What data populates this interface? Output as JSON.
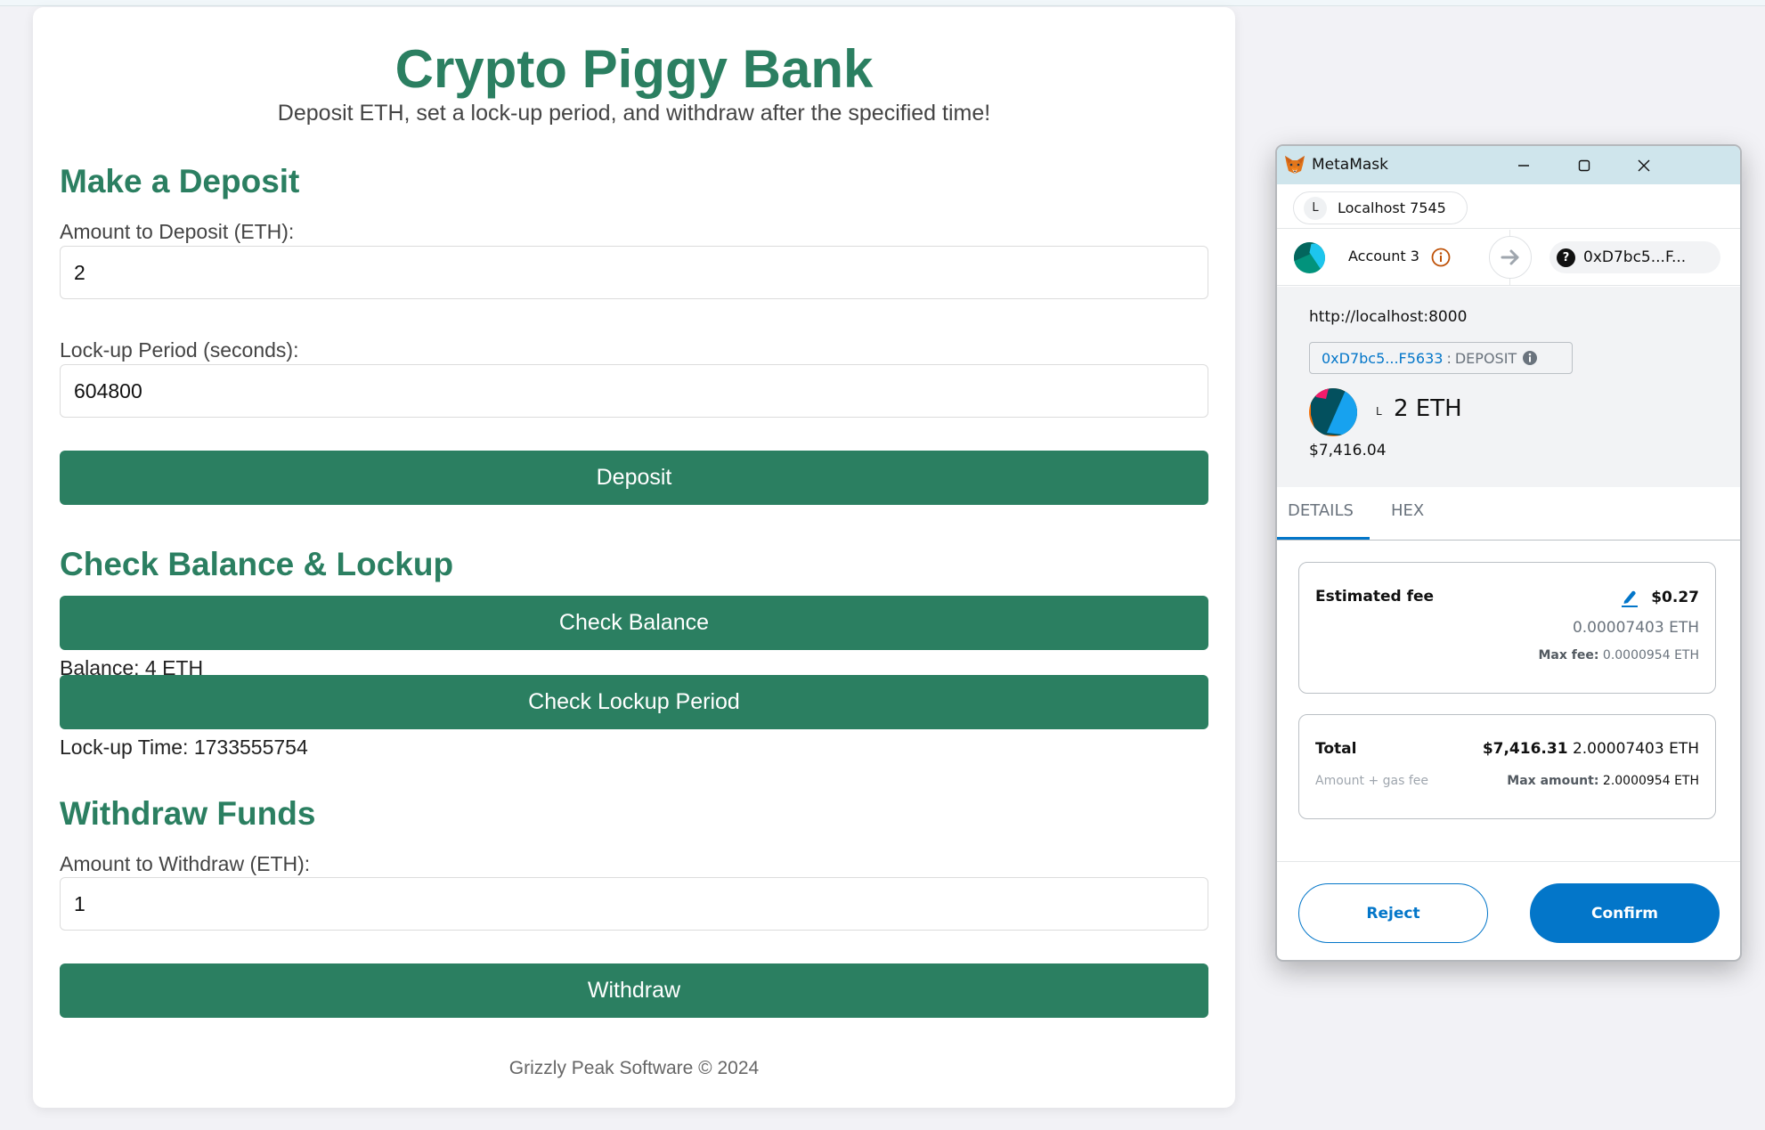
{
  "app": {
    "title": "Crypto Piggy Bank",
    "subtitle": "Deposit ETH, set a lock-up period, and withdraw after the specified time!",
    "footer": "Grizzly Peak Software © 2024",
    "accent_color": "#2b7f61"
  },
  "deposit": {
    "heading": "Make a Deposit",
    "amount_label": "Amount to Deposit (ETH):",
    "amount_value": "2",
    "lockup_label": "Lock-up Period (seconds):",
    "lockup_value": "604800",
    "button_label": "Deposit"
  },
  "check": {
    "heading": "Check Balance & Lockup",
    "balance_button": "Check Balance",
    "balance_result": "Balance: 4 ETH",
    "lockup_button": "Check Lockup Period",
    "lockup_result": "Lock-up Time: 1733555754"
  },
  "withdraw": {
    "heading": "Withdraw Funds",
    "amount_label": "Amount to Withdraw (ETH):",
    "amount_value": "1",
    "button_label": "Withdraw"
  },
  "metamask": {
    "window_title": "MetaMask",
    "network": {
      "initial": "L",
      "name": "Localhost 7545"
    },
    "account": {
      "name": "Account 3",
      "to_address": "0xD7bc5...F..."
    },
    "origin": "http://localhost:8000",
    "method": {
      "contract": "0xD7bc5...F5633",
      "separator": ":",
      "name": "DEPOSIT"
    },
    "value": {
      "network_initial": "L",
      "amount": "2 ETH",
      "usd": "$7,416.04"
    },
    "tabs": [
      {
        "label": "DETAILS",
        "active": true
      },
      {
        "label": "HEX",
        "active": false
      }
    ],
    "fee": {
      "label": "Estimated fee",
      "usd": "$0.27",
      "eth": "0.00007403 ETH",
      "max_label": "Max fee:",
      "max_value": "0.0000954 ETH"
    },
    "total": {
      "label": "Total",
      "sublabel": "Amount + gas fee",
      "usd": "$7,416.31",
      "eth": "2.00007403 ETH",
      "max_label": "Max amount:",
      "max_value": "2.0000954 ETH"
    },
    "buttons": {
      "reject": "Reject",
      "confirm": "Confirm"
    },
    "accent_color": "#0376c9"
  }
}
